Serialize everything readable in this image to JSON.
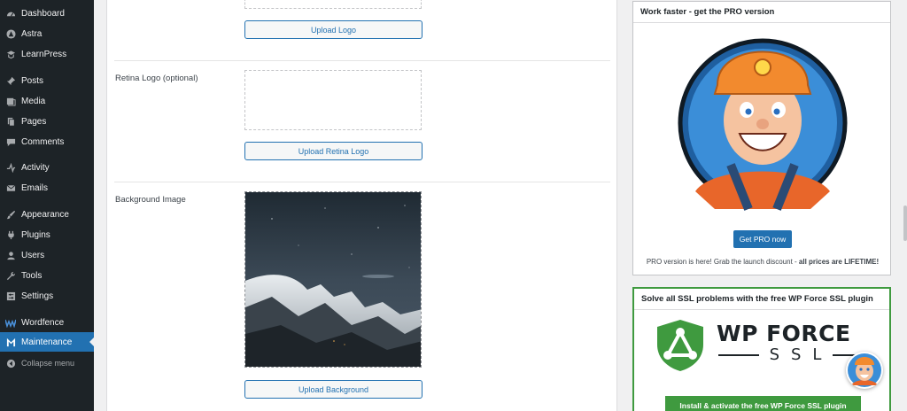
{
  "sidebar": {
    "items": [
      {
        "label": "Dashboard",
        "icon": "dashboard-icon"
      },
      {
        "label": "Astra",
        "icon": "astra-icon"
      },
      {
        "label": "LearnPress",
        "icon": "learnpress-icon"
      },
      {
        "label": "Posts",
        "icon": "pin-icon"
      },
      {
        "label": "Media",
        "icon": "media-icon"
      },
      {
        "label": "Pages",
        "icon": "pages-icon"
      },
      {
        "label": "Comments",
        "icon": "comment-icon"
      },
      {
        "label": "Activity",
        "icon": "activity-icon"
      },
      {
        "label": "Emails",
        "icon": "email-icon"
      },
      {
        "label": "Appearance",
        "icon": "brush-icon"
      },
      {
        "label": "Plugins",
        "icon": "plug-icon"
      },
      {
        "label": "Users",
        "icon": "user-icon"
      },
      {
        "label": "Tools",
        "icon": "wrench-icon"
      },
      {
        "label": "Settings",
        "icon": "settings-icon"
      },
      {
        "label": "Wordfence",
        "icon": "wordfence-icon"
      },
      {
        "label": "Maintenance",
        "icon": "maintenance-icon",
        "active": true
      },
      {
        "label": "Collapse menu",
        "icon": "collapse-icon"
      }
    ]
  },
  "form": {
    "upload_logo_label": "Upload Logo",
    "retina_label": "Retina Logo (optional)",
    "upload_retina_label": "Upload Retina Logo",
    "background_label": "Background Image",
    "upload_background_label": "Upload Background"
  },
  "pro_box": {
    "title": "Work faster - get the PRO version",
    "button": "Get PRO now",
    "note_prefix": "PRO version is here! Grab the launch discount - ",
    "note_bold": "all prices are LIFETIME!"
  },
  "ssl_box": {
    "title": "Solve all SSL problems with the free WP Force SSL plugin",
    "logo_line1": "WP FORCE",
    "logo_line2": "SSL",
    "button": "Install & activate the free WP Force SSL plugin"
  },
  "colors": {
    "sidebar_bg": "#1d2327",
    "accent": "#2271b1",
    "ssl_green": "#3f9a3f"
  }
}
